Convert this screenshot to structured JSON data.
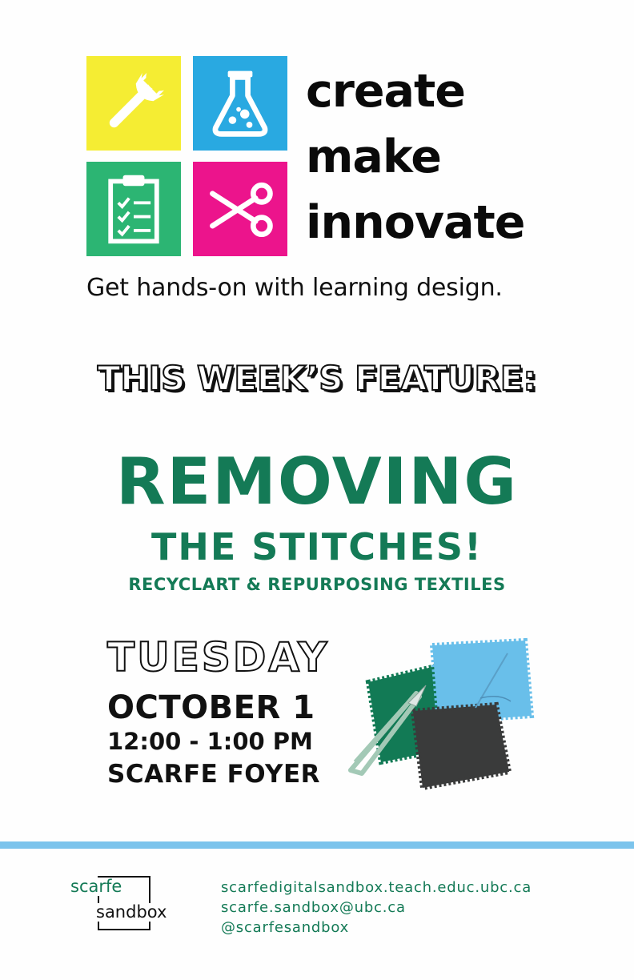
{
  "branding": {
    "tiles": [
      {
        "icon": "wrench-icon",
        "color": "#f5ed33"
      },
      {
        "icon": "flask-icon",
        "color": "#29a9e1"
      },
      {
        "icon": "clipboard-checklist-icon",
        "color": "#2cb573"
      },
      {
        "icon": "scissors-icon",
        "color": "#ec148c"
      }
    ],
    "slogan": [
      "create",
      "make",
      "innovate"
    ],
    "tagline": "Get hands-on with learning design."
  },
  "feature": {
    "heading": "THIS WEEK’S FEATURE:",
    "title_line1": "REMOVING",
    "title_line2": "THE STITCHES!",
    "subtitle": "RECYCLART & REPURPOSING TEXTILES",
    "accent_color": "#147a56"
  },
  "event": {
    "day": "TUESDAY",
    "date": "OCTOBER 1",
    "time": "12:00 - 1:00 PM",
    "location": "SCARFE FOYER"
  },
  "footer": {
    "divider_color": "#7cc4ec",
    "logo_line1": "scarfe",
    "logo_line2": "sandbox",
    "website": "scarfedigitalsandbox.teach.educ.ubc.ca",
    "email": "scarfe.sandbox@ubc.ca",
    "social": "@scarfesandbox"
  }
}
